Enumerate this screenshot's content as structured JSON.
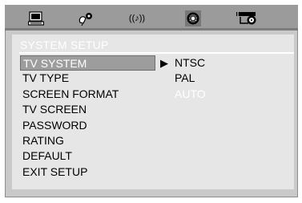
{
  "toolbar": {
    "icons": [
      "general-setup-icon",
      "speaker-icon",
      "audio-icon",
      "video-icon",
      "preference-icon"
    ],
    "audio_glyph": "((♪))"
  },
  "setup": {
    "title": "SYSTEM SETUP",
    "menu": [
      {
        "label": "TV  SYSTEM",
        "selected": true
      },
      {
        "label": "TV TYPE"
      },
      {
        "label": "SCREEN FORMAT"
      },
      {
        "label": "TV SCREEN"
      },
      {
        "label": "PASSWORD"
      },
      {
        "label": "RATING"
      },
      {
        "label": "DEFAULT"
      },
      {
        "label": "EXIT SETUP"
      }
    ],
    "pointer": "▶",
    "options": [
      {
        "label": "NTSC"
      },
      {
        "label": "PAL"
      },
      {
        "label": "AUTO",
        "highlighted": true
      }
    ]
  },
  "colors": {
    "highlight": "#9d9d9d",
    "panel": "#e6e6e6",
    "toolbar": "#9b9b9b"
  }
}
